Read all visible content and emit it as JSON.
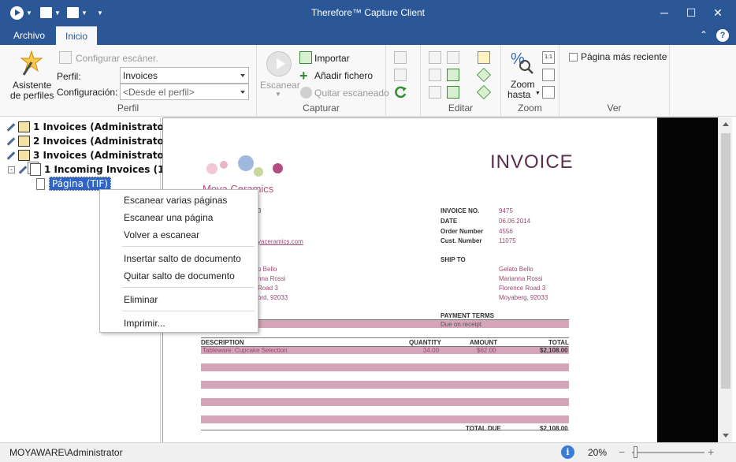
{
  "window": {
    "title": "Therefore™ Capture Client"
  },
  "tabs": [
    {
      "label": "Archivo"
    },
    {
      "label": "Inicio"
    }
  ],
  "ribbon": {
    "perfil": {
      "wizard_label_1": "Asistente",
      "wizard_label_2": "de perfiles",
      "configure_scanner": "Configurar escáner.",
      "profile_label": "Perfil:",
      "profile_value": "Invoices",
      "config_label": "Configuración:",
      "config_value": "<Desde el perfil>",
      "group_label": "Perfil"
    },
    "capturar": {
      "scan_label": "Escanear",
      "import_label": "Importar",
      "add_file_label": "Añadir fichero",
      "remove_scanned_label": "Quitar escaneado",
      "group_label": "Capturar"
    },
    "editar": {
      "group_label": "Editar"
    },
    "zoom": {
      "zoom_label_1": "Zoom",
      "zoom_label_2": "hasta",
      "fit_label": "1:1",
      "group_label": "Zoom"
    },
    "ver": {
      "recent_page_label": "Página más reciente",
      "recent_page_checked": false,
      "group_label": "Ver"
    }
  },
  "tree": {
    "items": [
      {
        "label": "1 Invoices (Administrator)"
      },
      {
        "label": "2 Invoices (Administrator)"
      },
      {
        "label": "3 Invoices (Administrator)"
      },
      {
        "label": "1 Incoming Invoices (1)"
      }
    ],
    "selected_page": "Página (TIF)"
  },
  "context_menu": {
    "items": [
      "Escanear varias páginas",
      "Escanear una página",
      "Volver a escanear",
      "Insertar salto de documento",
      "Quitar salto de documento",
      "Eliminar",
      "Imprimir..."
    ]
  },
  "invoice": {
    "title": "INVOICE",
    "company": "Moya Ceramics",
    "sender_partial": [
      "3",
      "yaceramics.com"
    ],
    "meta_labels": [
      "INVOICE NO.",
      "DATE",
      "Order Number",
      "Cust. Number"
    ],
    "meta_values": [
      "9475",
      "06.06.2014",
      "4556",
      "11075"
    ],
    "ship_to_label": "SHIP TO",
    "bill_partial": [
      "o Bello",
      "nna Rossi",
      "Road 3",
      "ord, 92033"
    ],
    "ship_to": [
      "Gelato Bello",
      "Marianna Rossi",
      "Florence Road 3",
      "Moyaberg, 92033"
    ],
    "payment_terms_label": "PAYMENT TERMS",
    "payment_terms_value": "Due on receipt",
    "col_description": "DESCRIPTION",
    "col_quantity": "QUANTITY",
    "col_amount": "AMOUNT",
    "col_total": "TOTAL",
    "line_description": "Tableware: Cupcake Selection",
    "line_quantity": "34.00",
    "line_amount": "$62.00",
    "line_total": "$2,108.00",
    "total_due_label": "TOTAL DUE",
    "total_due_value": "$2,108.00"
  },
  "status": {
    "user": "MOYAWARE\\Administrator",
    "zoom_percent": "20%",
    "zoom_minus": "−",
    "zoom_plus": "+"
  },
  "colors": {
    "title_bar": "#2b5797",
    "accent_pink": "#d4a5b8",
    "invoice_title": "#5b2d4e"
  }
}
